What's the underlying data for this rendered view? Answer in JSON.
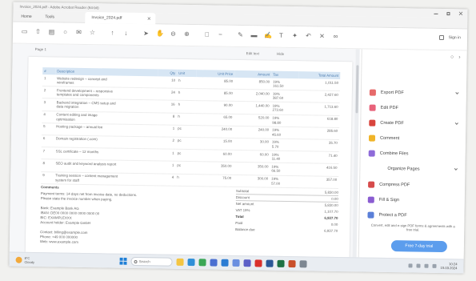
{
  "window": {
    "title": "Invoice_2024.pdf - Adobe Acrobat Reader (64-bit)"
  },
  "tabs": {
    "home": "Home",
    "tools": "Tools",
    "document": "Invoice_2024.pdf"
  },
  "toolbar": {
    "groups": [
      [
        "save-icon",
        "upload-icon",
        "print-icon",
        "search-icon",
        "mail-icon",
        "bookmark-icon"
      ],
      [
        "page-up-icon",
        "page-down-icon"
      ],
      [
        "cursor-icon",
        "hand-icon",
        "zoom-out-icon",
        "zoom-in-icon"
      ],
      [
        "fit-page-icon",
        "minus-icon"
      ],
      [
        "comment-icon",
        "highlight-icon",
        "pen-icon",
        "text-icon",
        "stamp-icon",
        "undo-icon",
        "delete-icon",
        "link-icon"
      ]
    ],
    "sign_in": "Sign in"
  },
  "subbar": {
    "left": "Page 1",
    "center": [
      "Edit text",
      "Hide"
    ]
  },
  "document": {
    "table": {
      "headers": [
        "#",
        "Description",
        "Qty",
        "Unit",
        "Unit Price",
        "Amount",
        "Tax",
        "Total Amount"
      ],
      "rows": [
        {
          "no": "1",
          "desc": [
            "Website redesign – concept and",
            "wireframes"
          ],
          "qty": "10",
          "unit": "h",
          "price": "85.00",
          "amount": "850.00",
          "tax": [
            "19%",
            "161.50"
          ],
          "total": "1,011.50"
        },
        {
          "no": "2",
          "desc": [
            "Frontend development – responsive",
            "templates and components"
          ],
          "qty": "24",
          "unit": "h",
          "price": "85.00",
          "amount": "2,040.00",
          "tax": [
            "19%",
            "387.60"
          ],
          "total": "2,427.60"
        },
        {
          "no": "3",
          "desc": [
            "Backend integration – CMS setup and",
            "data migration"
          ],
          "qty": "16",
          "unit": "h",
          "price": "90.00",
          "amount": "1,440.00",
          "tax": [
            "19%",
            "273.60"
          ],
          "total": "1,713.60"
        },
        {
          "no": "4",
          "desc": [
            "Content editing and image",
            "optimisation"
          ],
          "qty": "8",
          "unit": "h",
          "price": "65.00",
          "amount": "520.00",
          "tax": [
            "19%",
            "98.80"
          ],
          "total": "618.80"
        },
        {
          "no": "5",
          "desc": [
            "Hosting package – annual fee"
          ],
          "qty": "1",
          "unit": "pc",
          "price": "240.00",
          "amount": "240.00",
          "tax": [
            "19%",
            "45.60"
          ],
          "total": "285.60"
        },
        {
          "no": "6",
          "desc": [
            "Domain registration (.com)"
          ],
          "qty": "2",
          "unit": "pc",
          "price": "15.00",
          "amount": "30.00",
          "tax": [
            "19%",
            "5.70"
          ],
          "total": "35.70"
        },
        {
          "no": "7",
          "desc": [
            "SSL certificate – 12 months"
          ],
          "qty": "1",
          "unit": "pc",
          "price": "60.00",
          "amount": "60.00",
          "tax": [
            "19%",
            "11.40"
          ],
          "total": "71.40"
        },
        {
          "no": "8",
          "desc": [
            "SEO audit and keyword analysis report"
          ],
          "qty": "1",
          "unit": "pc",
          "price": "350.00",
          "amount": "350.00",
          "tax": [
            "19%",
            "66.50"
          ],
          "total": "416.50"
        },
        {
          "no": "9",
          "desc": [
            "Training session – content management",
            "system for staff"
          ],
          "qty": "4",
          "unit": "h",
          "price": "75.00",
          "amount": "300.00",
          "tax": [
            "19%",
            "57.00"
          ],
          "total": "357.00"
        }
      ]
    },
    "notes": {
      "heading": "Comments",
      "lines": [
        "Payment terms: 14 days net from invoice date, no deductions.",
        "Please state the invoice number when paying.",
        "",
        "Bank: Example Bank AG",
        "IBAN: DE00 0000 0000 0000 0000 00",
        "BIC: EXAMPLEXXX",
        "Account holder: Example GmbH",
        "",
        "Contact: billing@example.com",
        "Phone: +49 000 000000",
        "Web: www.example.com"
      ]
    },
    "totals": [
      {
        "label": "Subtotal",
        "value": "5,830.00"
      },
      {
        "label": "Discount",
        "value": "0.00"
      },
      {
        "label": "Net amount",
        "value": "5,830.00"
      },
      {
        "label": "VAT 19%",
        "value": "1,107.70"
      },
      {
        "label": "Total",
        "value": "6,937.70"
      },
      {
        "label": "Paid",
        "value": "0.00"
      },
      {
        "label": "Balance due",
        "value": "6,937.70"
      }
    ]
  },
  "right_pane": {
    "items": [
      {
        "label": "Export PDF",
        "icon": "export-pdf-icon",
        "color": "#e66a6a",
        "chevron": true
      },
      {
        "label": "Edit PDF",
        "icon": "edit-pdf-icon",
        "color": "#e8627a",
        "chevron": false
      },
      {
        "label": "Create PDF",
        "icon": "create-pdf-icon",
        "color": "#d9453d",
        "chevron": true
      },
      {
        "label": "Comment",
        "icon": "comment-icon",
        "color": "#f0b428",
        "chevron": false
      },
      {
        "label": "Combine Files",
        "icon": "combine-files-icon",
        "color": "#8e6bd9",
        "chevron": false
      },
      {
        "label": "Organize Pages",
        "icon": "",
        "color": "",
        "chevron": true
      },
      {
        "label": "Compress PDF",
        "icon": "compress-pdf-icon",
        "color": "#d64b4b",
        "chevron": false
      },
      {
        "label": "Fill & Sign",
        "icon": "fill-sign-icon",
        "color": "#8a5cd1",
        "chevron": false
      },
      {
        "label": "Protect a PDF",
        "icon": "protect-icon",
        "color": "#5a7fd8",
        "chevron": false
      }
    ],
    "promo": "Convert, edit and e-sign PDF forms & agreements with a free trial.",
    "button": "Free 7-day trial"
  },
  "taskbar": {
    "weather": [
      "8°C",
      "Cloudy"
    ],
    "search": "Search",
    "apps": [
      {
        "name": "file-explorer-icon",
        "color": "#f4c542"
      },
      {
        "name": "edge-icon",
        "color": "#2f8fd8"
      },
      {
        "name": "chrome-icon",
        "color": "#3aa757"
      },
      {
        "name": "store-icon",
        "color": "#4a6fd1"
      },
      {
        "name": "mail-app-icon",
        "color": "#2b7cd3"
      },
      {
        "name": "photos-icon",
        "color": "#6a8fe0"
      },
      {
        "name": "teams-icon",
        "color": "#5b5fc7"
      },
      {
        "name": "acrobat-icon",
        "color": "#d9302c"
      },
      {
        "name": "word-icon",
        "color": "#2b5797"
      },
      {
        "name": "excel-icon",
        "color": "#1e7145"
      },
      {
        "name": "powerpoint-icon",
        "color": "#c94f2b"
      },
      {
        "name": "settings-icon",
        "color": "#7d8792"
      }
    ],
    "time": "10:24",
    "date": "15.03.2024"
  }
}
